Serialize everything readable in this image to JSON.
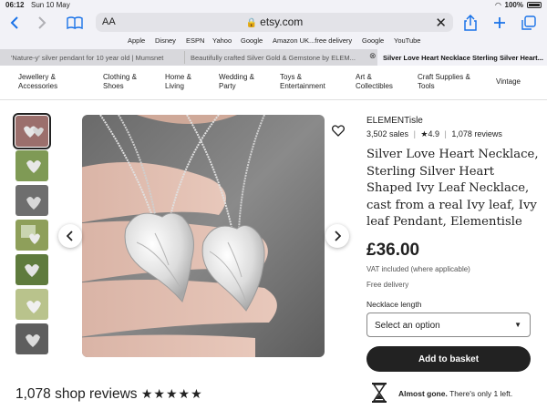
{
  "status": {
    "time": "06:12",
    "date": "Sun 10 May",
    "battery": "100%"
  },
  "toolbar": {
    "aa": "AA",
    "url": "etsy.com"
  },
  "favorites": [
    "Apple",
    "Disney",
    "ESPN",
    "Yahoo",
    "Google",
    "Amazon UK...free delivery",
    "Google",
    "YouTube"
  ],
  "tabs": [
    {
      "label": "'Nature-y' silver pendant for 10 year old | Mumsnet",
      "active": false
    },
    {
      "label": "Beautifully crafted Silver Gold & Gemstone by ELEM...",
      "active": false
    },
    {
      "label": "Silver Love Heart Necklace Sterling Silver Heart...",
      "active": true
    }
  ],
  "categories": [
    "Jewellery & Accessories",
    "Clothing & Shoes",
    "Home & Living",
    "Wedding & Party",
    "Toys & Entertainment",
    "Art & Collectibles",
    "Craft Supplies & Tools",
    "Vintage"
  ],
  "product": {
    "shop_name": "ELEMENTisle",
    "sales": "3,502 sales",
    "rating": "4.9",
    "reviews": "1,078 reviews",
    "title": "Silver Love Heart Necklace, Sterling Silver Heart Shaped Ivy Leaf Necklace, cast from a real Ivy leaf, Ivy leaf Pendant, Elementisle",
    "price": "£36.00",
    "vat": "VAT included (where applicable)",
    "delivery": "Free delivery",
    "option_label": "Necklace length",
    "option_placeholder": "Select an option",
    "add_button": "Add to basket",
    "stock_strong": "Almost gone.",
    "stock_text": "There's only 1 left."
  },
  "reviews": {
    "title": "1,078 shop reviews",
    "stars": "★★★★★"
  },
  "icons": {
    "back": "chevron-left-icon",
    "forward": "chevron-right-icon",
    "bookmarks": "book-icon",
    "lock": "lock-icon",
    "share": "share-icon",
    "new_tab": "plus-icon",
    "tabs": "tabs-icon",
    "favorite": "heart-icon",
    "hourglass": "hourglass-icon"
  }
}
